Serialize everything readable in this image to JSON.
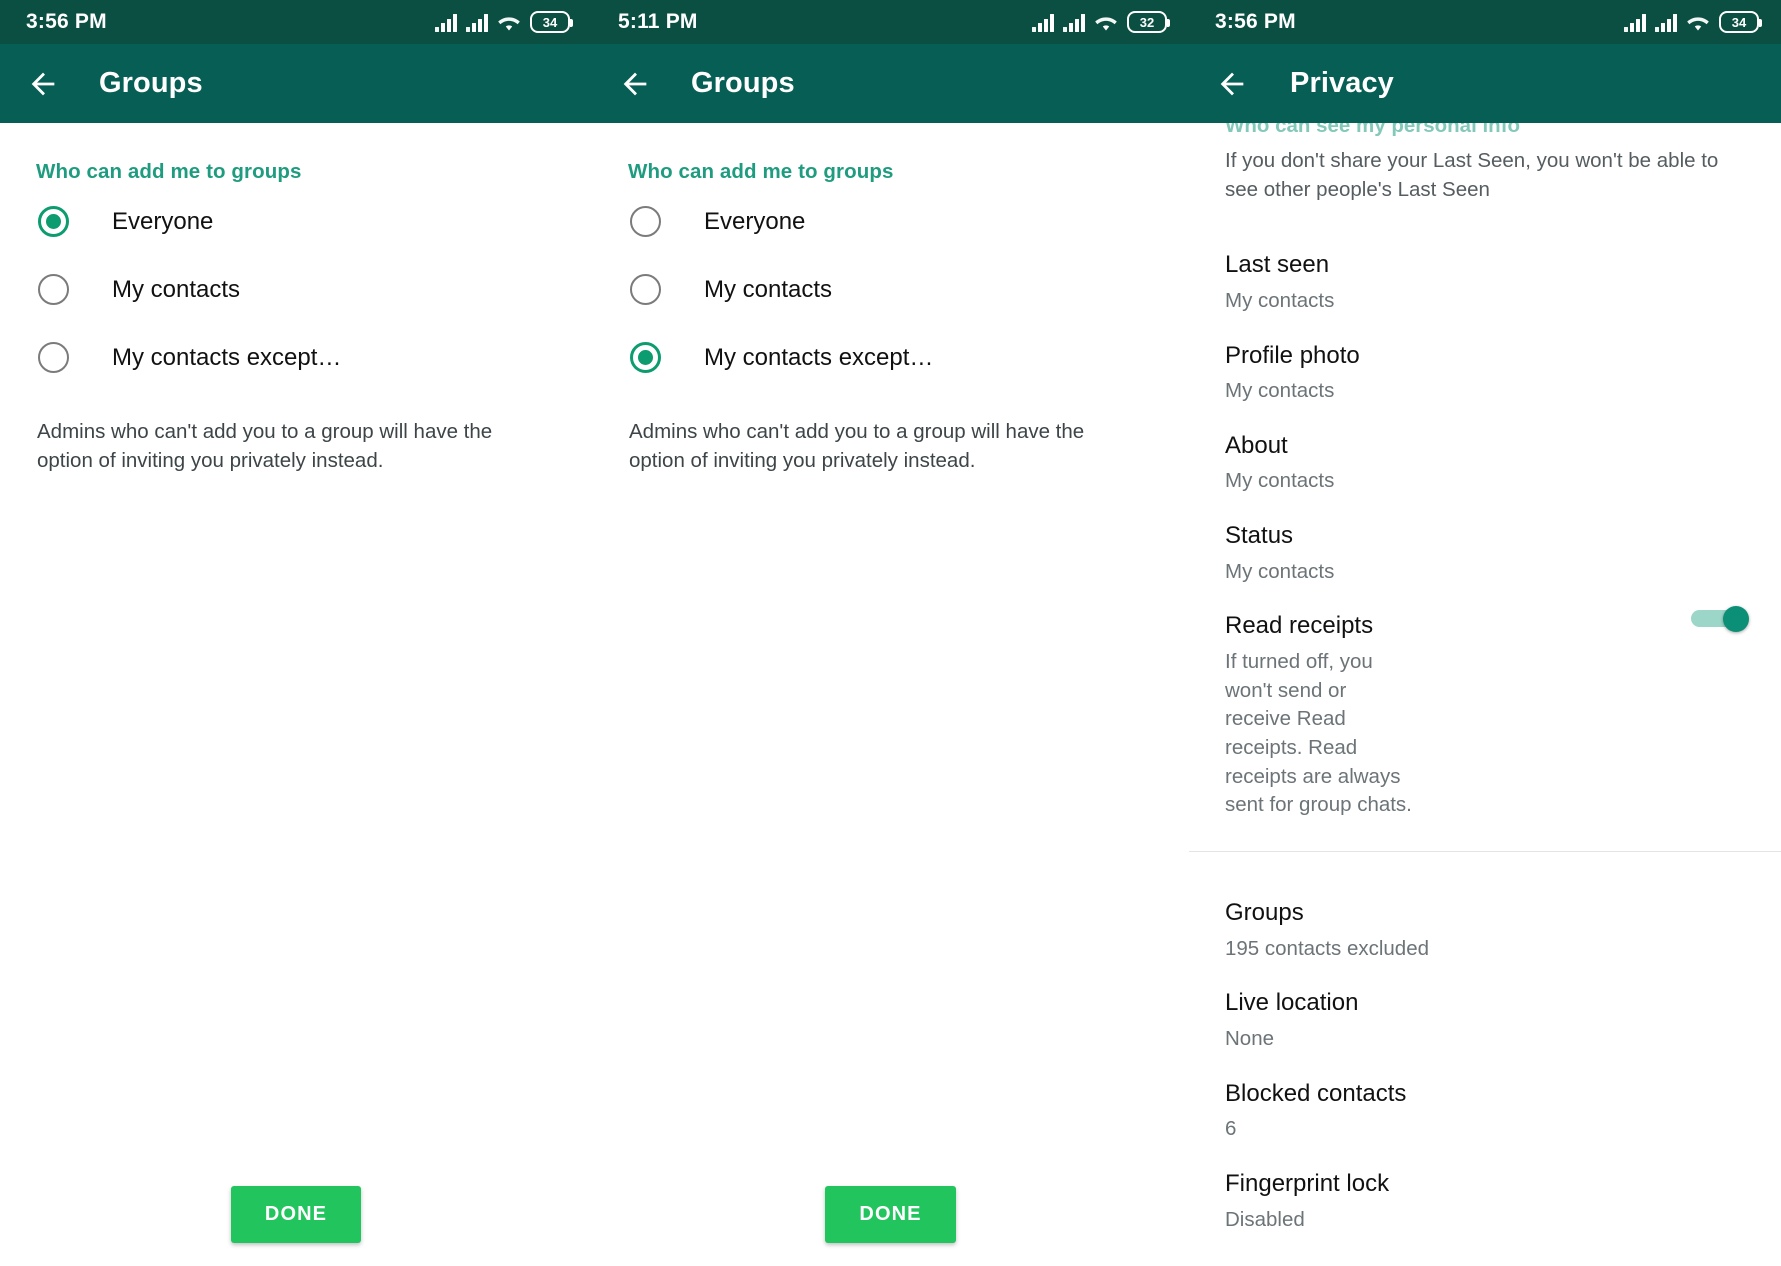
{
  "panels": [
    {
      "statusbar": {
        "time": "3:56 PM",
        "battery": "34",
        "wifi_icon": "wifi-icon",
        "signal_icon": "signal-bars-icon"
      },
      "toolbar": {
        "title": "Groups",
        "back_icon": "back-arrow-icon"
      },
      "section_header": "Who can add me to groups",
      "options": [
        {
          "label": "Everyone",
          "selected": true
        },
        {
          "label": "My contacts",
          "selected": false
        },
        {
          "label": "My contacts except…",
          "selected": false
        }
      ],
      "note": "Admins who can't add you to a group will have the option of inviting you privately instead.",
      "done_label": "DONE"
    },
    {
      "statusbar": {
        "time": "5:11 PM",
        "battery": "32",
        "wifi_icon": "wifi-icon",
        "signal_icon": "signal-bars-icon"
      },
      "toolbar": {
        "title": "Groups",
        "back_icon": "back-arrow-icon"
      },
      "section_header": "Who can add me to groups",
      "options": [
        {
          "label": "Everyone",
          "selected": false
        },
        {
          "label": "My contacts",
          "selected": false
        },
        {
          "label": "My contacts except…",
          "selected": true
        }
      ],
      "note": "Admins who can't add you to a group will have the option of inviting you privately instead.",
      "done_label": "DONE"
    },
    {
      "statusbar": {
        "time": "3:56 PM",
        "battery": "34",
        "wifi_icon": "wifi-icon",
        "signal_icon": "signal-bars-icon"
      },
      "toolbar": {
        "title": "Privacy",
        "back_icon": "back-arrow-icon"
      },
      "scrolled_header": "Who can see my personal info",
      "hint": "If you don't share your Last Seen, you won't be able to see other people's Last Seen",
      "rows": [
        {
          "title": "Last seen",
          "sub": "My contacts"
        },
        {
          "title": "Profile photo",
          "sub": "My contacts"
        },
        {
          "title": "About",
          "sub": "My contacts"
        },
        {
          "title": "Status",
          "sub": "My contacts"
        },
        {
          "title": "Read receipts",
          "sub": "If turned off, you won't send or receive Read receipts. Read receipts are always sent for group chats.",
          "toggle": "on"
        },
        {
          "title": "Groups",
          "sub": "195 contacts excluded"
        },
        {
          "title": "Live location",
          "sub": "None"
        },
        {
          "title": "Blocked contacts",
          "sub": "6"
        },
        {
          "title": "Fingerprint lock",
          "sub": "Disabled"
        }
      ]
    }
  ],
  "colors": {
    "status_bar": "#0b4f43",
    "toolbar": "#075e54",
    "accent_teal": "#1f9c7f",
    "radio_selected": "#0c9c6f",
    "done_green": "#21c45d",
    "toggle_on": "#0b8f76"
  }
}
